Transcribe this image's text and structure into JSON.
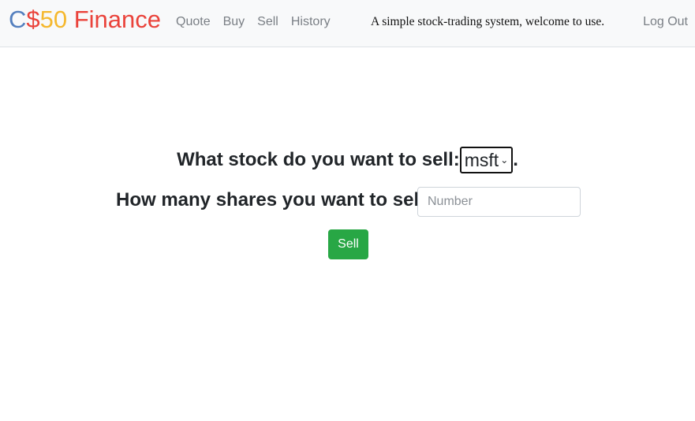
{
  "navbar": {
    "brand": {
      "part1": "C",
      "part2": "$",
      "part3": "50",
      "part4": " Finance"
    },
    "links": [
      "Quote",
      "Buy",
      "Sell",
      "History"
    ],
    "tagline": "A simple stock-trading system, welcome to use.",
    "logout_label": "Log Out"
  },
  "form": {
    "stock_prompt": "What stock do you want to sell:",
    "stock_selected": "msft",
    "stock_prompt_end": ".",
    "shares_prompt": "How many shares you want to sell:",
    "shares_placeholder": "Number",
    "submit_label": "Sell"
  },
  "colors": {
    "brand_blue": "#537fbe",
    "brand_red": "#ea433b",
    "brand_yellow": "#f5b82e",
    "brand_green": "#2e944b",
    "button_green": "#28a745"
  }
}
